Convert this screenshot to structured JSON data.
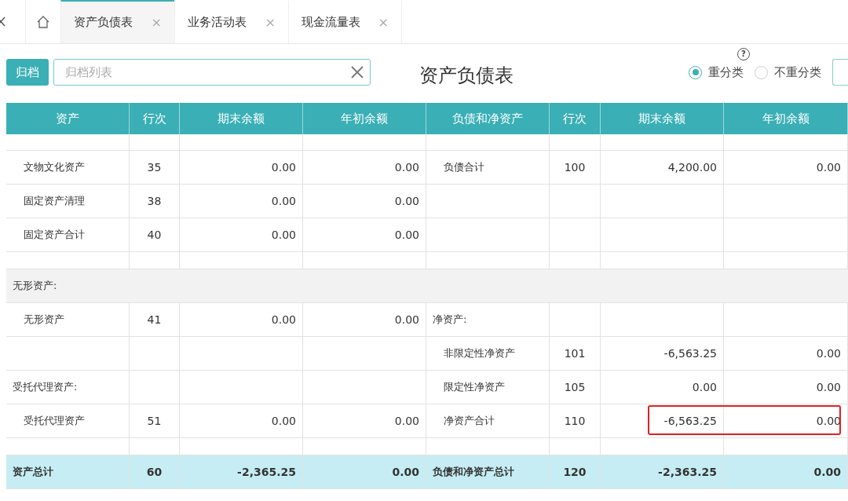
{
  "tabs": [
    {
      "label": "资产负债表",
      "selected": true,
      "close": "×"
    },
    {
      "label": "业务活动表",
      "selected": false,
      "close": "×"
    },
    {
      "label": "现金流量表",
      "selected": false,
      "close": "×"
    }
  ],
  "toolbar": {
    "archive_button": "归档",
    "archive_field": {
      "placeholder": "归档列表"
    },
    "title": "资产负债表",
    "help": "?",
    "options": [
      {
        "label": "重分类",
        "selected": true
      },
      {
        "label": "不重分类",
        "selected": false
      }
    ]
  },
  "table": {
    "columns": [
      "资产",
      "行次",
      "期末余额",
      "年初余额",
      "负债和净资产",
      "行次",
      "期末余额",
      "年初余额"
    ],
    "rows": [
      {
        "kind": "partial"
      },
      {
        "kind": "data",
        "highlighted": false,
        "left": {
          "kind": "item",
          "label": "文物文化资产",
          "line": "35",
          "end": "0.00",
          "begin": "0.00"
        },
        "right": {
          "kind": "item",
          "label": "负债合计",
          "line": "100",
          "end": "4,200.00",
          "begin": "0.00"
        }
      },
      {
        "kind": "data",
        "highlighted": false,
        "left": {
          "kind": "item",
          "label": "固定资产清理",
          "line": "38",
          "end": "0.00",
          "begin": "0.00"
        }
      },
      {
        "kind": "data",
        "highlighted": false,
        "left": {
          "kind": "item",
          "label": "固定资产合计",
          "line": "40",
          "end": "0.00",
          "begin": "0.00"
        }
      },
      {
        "kind": "blank"
      },
      {
        "kind": "section",
        "left": {
          "kind": "heading",
          "label": "无形资产:"
        }
      },
      {
        "kind": "data",
        "highlighted": false,
        "left": {
          "kind": "item",
          "label": "无形资产",
          "line": "41",
          "end": "0.00",
          "begin": "0.00"
        },
        "right": {
          "kind": "heading",
          "label": "净资产:"
        }
      },
      {
        "kind": "data",
        "highlighted": false,
        "right": {
          "kind": "item",
          "label": "非限定性净资产",
          "line": "101",
          "end": "-6,563.25",
          "begin": "0.00"
        }
      },
      {
        "kind": "data",
        "highlighted": false,
        "left": {
          "kind": "heading",
          "label": "受托代理资产:"
        },
        "right": {
          "kind": "item",
          "label": "限定性净资产",
          "line": "105",
          "end": "0.00",
          "begin": "0.00"
        }
      },
      {
        "kind": "data",
        "highlighted": true,
        "left": {
          "kind": "item",
          "label": "受托代理资产",
          "line": "51",
          "end": "0.00",
          "begin": "0.00"
        },
        "right": {
          "kind": "item",
          "label": "净资产合计",
          "line": "110",
          "end": "-6,563.25",
          "begin": "0.00"
        }
      },
      {
        "kind": "blank"
      },
      {
        "kind": "total",
        "left": {
          "kind": "heading",
          "label": "资产总计",
          "line": "60",
          "end": "-2,365.25",
          "begin": "0.00"
        },
        "right": {
          "kind": "heading",
          "label": "负债和净资产总计",
          "line": "120",
          "end": "-2,363.25",
          "begin": "0.00"
        }
      }
    ]
  }
}
